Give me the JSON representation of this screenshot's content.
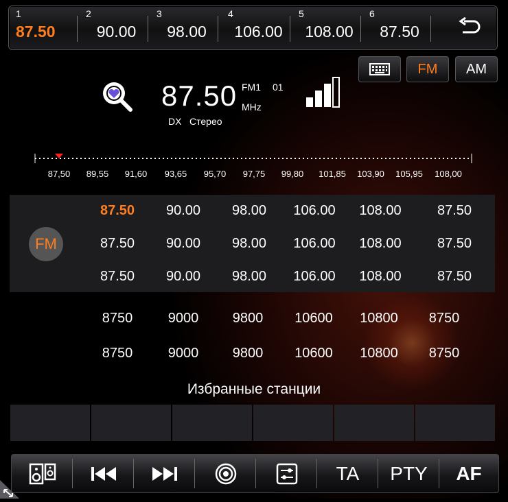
{
  "presets": [
    {
      "num": "1",
      "freq": "87.50"
    },
    {
      "num": "2",
      "freq": "90.00"
    },
    {
      "num": "3",
      "freq": "98.00"
    },
    {
      "num": "4",
      "freq": "106.00"
    },
    {
      "num": "5",
      "freq": "108.00"
    },
    {
      "num": "6",
      "freq": "87.50"
    }
  ],
  "modes": {
    "keyboard_icon": "keyboard-icon",
    "fm": "FM",
    "am": "AM"
  },
  "display": {
    "frequency": "87.50",
    "band": "FM1",
    "preset_index": "01",
    "unit": "MHz",
    "dx": "DX",
    "stereo": "Стерео"
  },
  "scale_labels": [
    "87,50",
    "89,55",
    "91,60",
    "93,65",
    "95,70",
    "97,75",
    "99,80",
    "101,85",
    "103,90",
    "105,95",
    "108,00"
  ],
  "grid": {
    "band_label": "FM",
    "rows": [
      [
        "87.50",
        "90.00",
        "98.00",
        "106.00",
        "108.00",
        "87.50"
      ],
      [
        "87.50",
        "90.00",
        "98.00",
        "106.00",
        "108.00",
        "87.50"
      ],
      [
        "87.50",
        "90.00",
        "98.00",
        "106.00",
        "108.00",
        "87.50"
      ]
    ],
    "plain_rows": [
      [
        "8750",
        "9000",
        "9800",
        "10600",
        "10800",
        "8750"
      ],
      [
        "8750",
        "9000",
        "9800",
        "10600",
        "10800",
        "8750"
      ]
    ]
  },
  "favorites_title": "Избранные станции",
  "controls": {
    "ta": "TA",
    "pty": "PTY",
    "af": "AF"
  },
  "colors": {
    "accent": "#ff7e1f"
  }
}
